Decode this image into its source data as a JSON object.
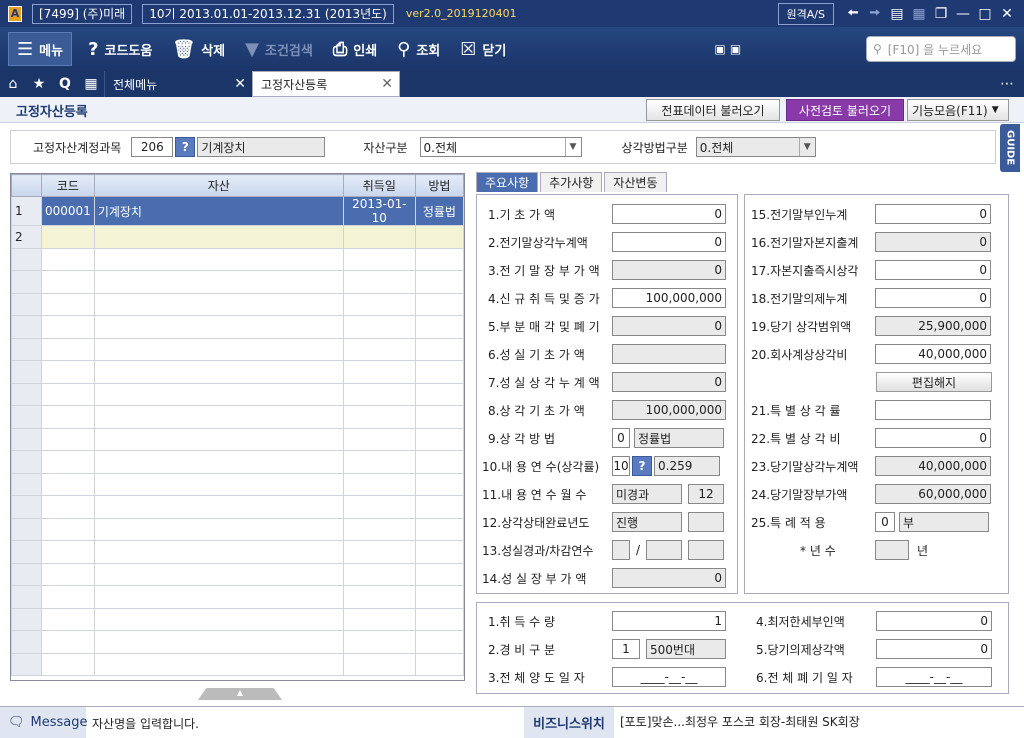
{
  "titlebar": {
    "icon_letter": "A",
    "company": "[7499] (주)미래",
    "period": "10기 2013.01.01-2013.12.31 (2013년도)",
    "version": "ver2.0_2019120401",
    "remote": "원격A/S"
  },
  "toolbar": {
    "menu": "메뉴",
    "codehelp": "코드도움",
    "delete": "삭제",
    "condsearch": "조건검색",
    "print": "인쇄",
    "inquiry": "조회",
    "close": "닫기",
    "search_placeholder": "[F10] 을 누르세요"
  },
  "tabs": {
    "all_menu": "전체메뉴",
    "current": "고정자산등록"
  },
  "header": {
    "title": "고정자산등록",
    "btn_slip": "전표데이터 불러오기",
    "btn_precheck": "사전검토 불러오기",
    "btn_functions": "기능모음(F11)"
  },
  "filter": {
    "account_label": "고정자산계정과목",
    "account_code": "206",
    "account_name": "기계장치",
    "asset_type_label": "자산구분",
    "asset_type_value": "0.전체",
    "depr_method_label": "상각방법구분",
    "depr_method_value": "0.전체"
  },
  "guide": "GUIDE",
  "grid": {
    "headers": [
      "코드",
      "자산",
      "취득일",
      "방법"
    ],
    "rows": [
      {
        "num": "1",
        "code": "000001",
        "asset": "기계장치",
        "date": "2013-01-10",
        "method": "정률법"
      },
      {
        "num": "2",
        "code": "",
        "asset": "",
        "date": "",
        "method": ""
      }
    ]
  },
  "detail_tabs": [
    "주요사항",
    "추가사항",
    "자산변동"
  ],
  "main_left": [
    {
      "label": "1.기 초 가 액",
      "value": "0",
      "gray": false
    },
    {
      "label": "2.전기말상각누계액",
      "value": "0",
      "gray": false
    },
    {
      "label": "3.전 기 말 장 부 가 액",
      "value": "0",
      "gray": true
    },
    {
      "label": "4.신 규 취 득 및 증 가",
      "value": "100,000,000",
      "gray": false
    },
    {
      "label": "5.부 분 매 각 및 폐 기",
      "value": "0",
      "gray": true
    },
    {
      "label": "6.성 실 기 초 가 액",
      "value": "",
      "gray": true
    },
    {
      "label": "7.성 실 상 각 누 계 액",
      "value": "0",
      "gray": true
    },
    {
      "label": "8.상 각 기 초 가 액",
      "value": "100,000,000",
      "gray": true
    }
  ],
  "row9": {
    "label": "9.상 각 방 법",
    "code": "0",
    "value": "정률법"
  },
  "row10": {
    "label": "10.내 용 연 수(상각률)",
    "years": "10",
    "rate": "0.259"
  },
  "row11": {
    "label": "11.내 용 연 수 월 수",
    "status": "미경과",
    "months": "12"
  },
  "row12": {
    "label": "12.상각상태완료년도",
    "status": "진행",
    "value": ""
  },
  "row13": {
    "label": "13.성실경과/차감연수",
    "slash": "/"
  },
  "row14": {
    "label": "14.성 실 장 부 가 액",
    "value": "0"
  },
  "main_right": [
    {
      "label": "15.전기말부인누계",
      "value": "0",
      "gray": false
    },
    {
      "label": "16.전기말자본지출계",
      "value": "0",
      "gray": true
    },
    {
      "label": "17.자본지출즉시상각",
      "value": "0",
      "gray": false
    },
    {
      "label": "18.전기말의제누계",
      "value": "0",
      "gray": false
    },
    {
      "label": "19.당기 상각범위액",
      "value": "25,900,000",
      "gray": true
    },
    {
      "label": "20.회사계상상각비",
      "value": "40,000,000",
      "gray": false
    }
  ],
  "edit_release": "편집해지",
  "main_right2": [
    {
      "label": "21.특 별 상 각 률",
      "value": "",
      "gray": false
    },
    {
      "label": "22.특 별 상 각 비",
      "value": "0",
      "gray": false
    },
    {
      "label": "23.당기말상각누계액",
      "value": "40,000,000",
      "gray": true
    },
    {
      "label": "24.당기말장부가액",
      "value": "60,000,000",
      "gray": true
    }
  ],
  "row25": {
    "label": "25.특 례 적 용",
    "code": "0",
    "value": "부"
  },
  "years_row": {
    "label": "* 년 수",
    "unit": "년"
  },
  "bottom_left": {
    "qty_label": "1.취 득 수 량",
    "qty": "1",
    "exp_label": "2.경 비 구 분",
    "exp_code": "1",
    "exp_value": "500번대",
    "disp_label": "3.전 체 양 도 일 자",
    "disp_value": "____-__-__"
  },
  "bottom_right": {
    "min_label": "4.최저한세부인액",
    "min": "0",
    "deemed_label": "5.당기의제상각액",
    "deemed": "0",
    "scrap_label": "6.전 체 폐 기 일 자",
    "scrap": "____-__-__"
  },
  "status": {
    "message_label": "Message",
    "message": "자산명을 입력합니다.",
    "biz_label": "비즈니스위치",
    "biz_text": "[포토]맞손...최정우 포스코 회장-최태원 SK회장"
  }
}
